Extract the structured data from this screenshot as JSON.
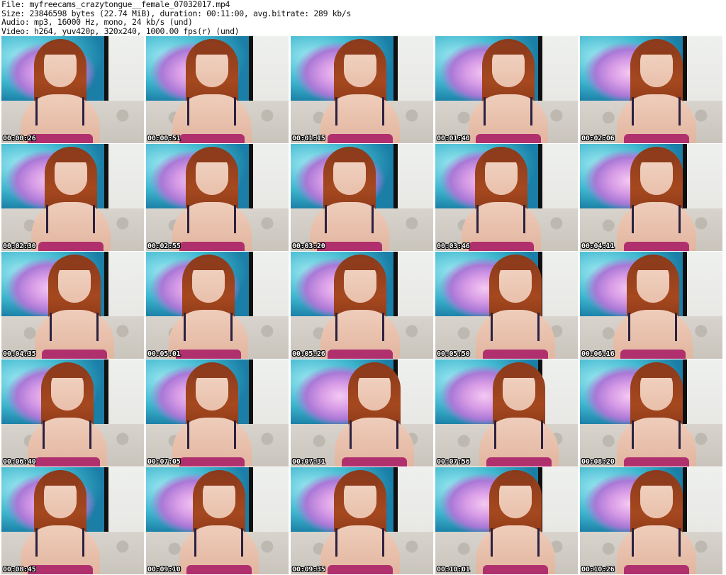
{
  "header": {
    "file_line": "File: myfreecams_crazytongue__female_07032017.mp4",
    "size_line": "Size: 23846598 bytes (22.74 MiB), duration: 00:11:00, avg.bitrate: 289 kb/s",
    "audio_line": "Audio: mp3, 16000 Hz, mono, 24 kb/s (und)",
    "video_line": "Video: h264, yuv420p, 320x240, 1000.00 fps(r) (und)"
  },
  "thumbnails": [
    {
      "timestamp": "00:00:26"
    },
    {
      "timestamp": "00:00:51"
    },
    {
      "timestamp": "00:01:15"
    },
    {
      "timestamp": "00:01:40"
    },
    {
      "timestamp": "00:02:06"
    },
    {
      "timestamp": "00:02:30"
    },
    {
      "timestamp": "00:02:55"
    },
    {
      "timestamp": "00:03:20"
    },
    {
      "timestamp": "00:03:46"
    },
    {
      "timestamp": "00:04:11"
    },
    {
      "timestamp": "00:04:35"
    },
    {
      "timestamp": "00:05:01"
    },
    {
      "timestamp": "00:05:26"
    },
    {
      "timestamp": "00:05:50"
    },
    {
      "timestamp": "00:06:16"
    },
    {
      "timestamp": "00:06:40"
    },
    {
      "timestamp": "00:07:05"
    },
    {
      "timestamp": "00:07:31"
    },
    {
      "timestamp": "00:07:56"
    },
    {
      "timestamp": "00:08:20"
    },
    {
      "timestamp": "00:08:45"
    },
    {
      "timestamp": "00:09:10"
    },
    {
      "timestamp": "00:09:35"
    },
    {
      "timestamp": "00:10:01"
    },
    {
      "timestamp": "00:10:26"
    }
  ]
}
